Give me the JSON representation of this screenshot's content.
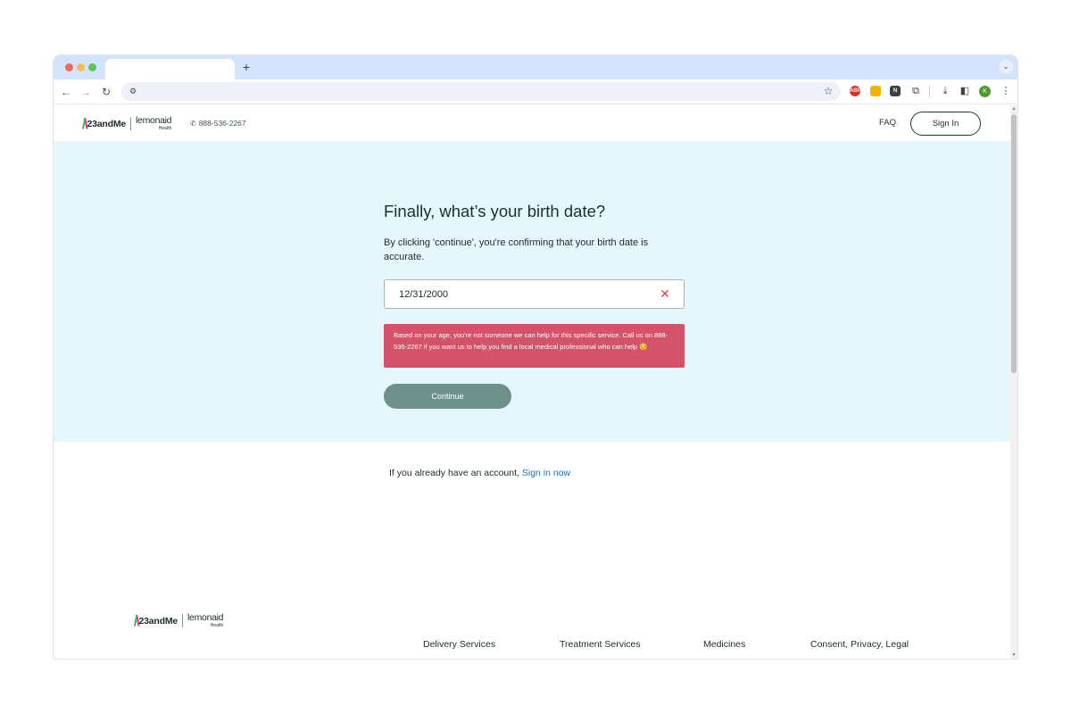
{
  "browser": {
    "new_tab_label": "+",
    "profile_initial": "K",
    "ext_abp": "ABP"
  },
  "header": {
    "logo_23": "23andMe",
    "logo_lemonaid": "lemonaid",
    "logo_health": "Health",
    "phone": "888-536-2267",
    "faq": "FAQ",
    "sign_in": "Sign In"
  },
  "form": {
    "title": "Finally, what’s your birth date?",
    "description": "By clicking 'continue', you're confirming that your birth date is accurate.",
    "birth_date_value": "12/31/2000",
    "error_message": "Based on your age, you're not someone we can help for this specific service. Call us on 888-536-2267 if you want us to help you find a local medical professional who can help 😔",
    "continue_label": "Continue"
  },
  "account": {
    "prompt": "If you already have an account,",
    "link": "Sign in now"
  },
  "footer": {
    "logo_23": "23andMe",
    "logo_lemonaid": "lemonaid",
    "logo_health": "Health",
    "nav": [
      "Delivery Services",
      "Treatment Services",
      "Medicines",
      "Consent, Privacy, Legal"
    ]
  },
  "colors": {
    "hero_background": "#e6f6fd",
    "error": "#d3536a",
    "button": "#6e9289",
    "link": "#1a73b8"
  },
  "icons": [
    "back-icon",
    "forward-icon",
    "reload-icon",
    "site-info-icon",
    "star-icon",
    "download-icon",
    "sidepanel-icon",
    "more-icon",
    "phone-icon",
    "clear-icon"
  ]
}
